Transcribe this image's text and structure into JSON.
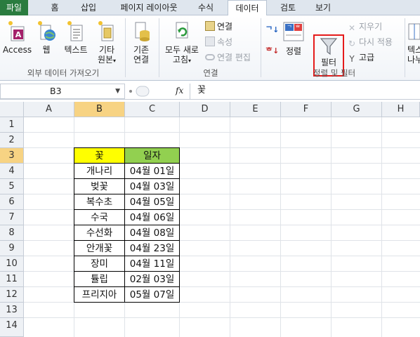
{
  "tabs": [
    "파일",
    "홈",
    "삽입",
    "페이지 레이아웃",
    "수식",
    "데이터",
    "검토",
    "보기"
  ],
  "active_tab": "데이터",
  "ribbon": {
    "external": {
      "access": "Access",
      "web": "웹",
      "text": "텍스트",
      "other_line1": "기타",
      "other_line2": "원본",
      "label": "외부 데이터 가져오기"
    },
    "existing_line1": "기존",
    "existing_line2": "연결",
    "connections": {
      "refresh_line1": "모두 새로",
      "refresh_line2": "고침",
      "connect": "연결",
      "properties": "속성",
      "edit_links": "연결 편집",
      "label": "연결"
    },
    "sort_filter": {
      "sort": "정렬",
      "filter": "필터",
      "clear": "지우기",
      "reapply": "다시 적용",
      "advanced": "고급",
      "label": "정렬 및 필터"
    },
    "text_to_columns_line1": "텍스",
    "text_to_columns_line2": "나누"
  },
  "formula_bar": {
    "name_box": "B3",
    "fx": "fx",
    "formula": "꽃"
  },
  "columns": [
    "A",
    "B",
    "C",
    "D",
    "E",
    "F",
    "G",
    "H"
  ],
  "rows": [
    "1",
    "2",
    "3",
    "4",
    "5",
    "6",
    "7",
    "8",
    "9",
    "10",
    "11",
    "12",
    "13",
    "14"
  ],
  "table": {
    "headers": [
      "꽃",
      "일자"
    ],
    "rows": [
      [
        "개나리",
        "04월 01일"
      ],
      [
        "벚꽃",
        "04월 03일"
      ],
      [
        "복수초",
        "04월 05일"
      ],
      [
        "수국",
        "04월 06일"
      ],
      [
        "수선화",
        "04월 08일"
      ],
      [
        "안개꽃",
        "04월 23일"
      ],
      [
        "장미",
        "04월 11일"
      ],
      [
        "튤립",
        "02월 03일"
      ],
      [
        "프리지아",
        "05월 07일"
      ]
    ]
  },
  "colors": {
    "header_b_fill": "#ffff00",
    "header_c_fill": "#92d050",
    "file_tab": "#2a7c3f",
    "highlight_border": "#e51b1b"
  }
}
